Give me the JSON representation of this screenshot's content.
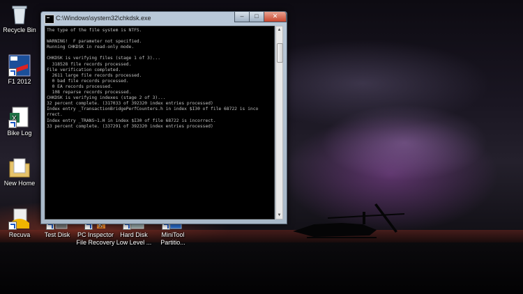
{
  "desktop": {
    "icons": [
      {
        "label": "Recycle Bin"
      },
      {
        "label": "F1 2012"
      },
      {
        "label": "Bike Log"
      },
      {
        "label": "New Home"
      },
      {
        "label": "Recuva"
      },
      {
        "label": "Test Disk"
      },
      {
        "label": "PC Inspector File Recovery"
      },
      {
        "label": "Hard Disk Low Level ..."
      },
      {
        "label": "MiniTool Partitio..."
      }
    ]
  },
  "window": {
    "title": "C:\\Windows\\system32\\chkdsk.exe",
    "buttons": {
      "minimize": "–",
      "maximize": "□",
      "close": "✕"
    },
    "console_lines": [
      "The type of the file system is NTFS.",
      "",
      "WARNING!  F parameter not specified.",
      "Running CHKDSK in read-only mode.",
      "",
      "CHKDSK is verifying files (stage 1 of 3)...",
      "  318528 file records processed.",
      "File verification completed.",
      "  2611 large file records processed.",
      "  0 bad file records processed.",
      "  0 EA records processed.",
      "  108 reparse records processed.",
      "CHKDSK is verifying indexes (stage 2 of 3)...",
      "32 percent complete. (317033 of 392320 index entries processed)",
      "Index entry _TransactionBridgePerfCounters.h in index $I30 of file 68722 is inco",
      "rrect.",
      "Index entry _TRANS~1.H in index $I30 of file 68722 is incorrect.",
      "33 percent complete. (337291 of 392320 index entries processed)"
    ]
  },
  "colors": {
    "console_bg": "#000000",
    "console_text": "#c0c0c0",
    "close_button": "#c8452d"
  }
}
